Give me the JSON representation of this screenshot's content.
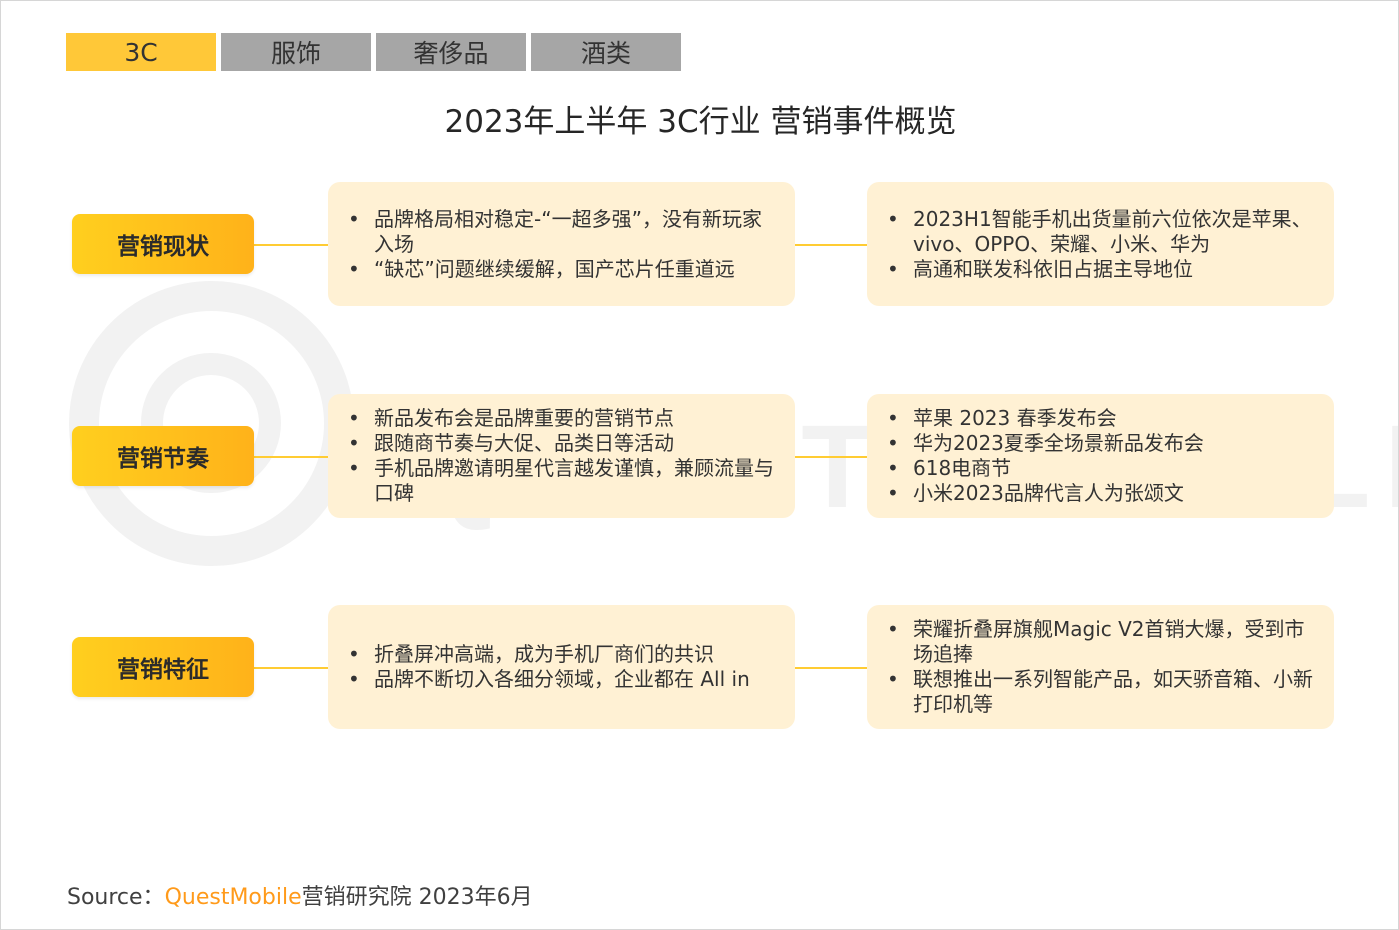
{
  "tabs": [
    {
      "label": "3C",
      "active": true
    },
    {
      "label": "服饰",
      "active": false
    },
    {
      "label": "奢侈品",
      "active": false
    },
    {
      "label": "酒类",
      "active": false
    }
  ],
  "title": "2023年上半年 3C行业 营销事件概览",
  "watermark": "QUEST MOBILE",
  "rows": [
    {
      "label": "营销现状",
      "left": [
        "品牌格局相对稳定-“一超多强”，没有新玩家入场",
        "“缺芯”问题继续缓解，国产芯片任重道远"
      ],
      "right": [
        "2023H1智能手机出货量前六位依次是苹果、vivo、OPPO、荣耀、小米、华为",
        "高通和联发科依旧占据主导地位"
      ]
    },
    {
      "label": "营销节奏",
      "left": [
        "新品发布会是品牌重要的营销节点",
        "跟随商节奏与大促、品类日等活动",
        "手机品牌邀请明星代言越发谨慎，兼顾流量与口碑"
      ],
      "right": [
        "苹果 2023 春季发布会",
        "华为2023夏季全场景新品发布会",
        "618电商节",
        "小米2023品牌代言人为张颂文"
      ]
    },
    {
      "label": "营销特征",
      "left": [
        "折叠屏冲高端，成为手机厂商们的共识",
        "品牌不断切入各细分领域，企业都在 All in"
      ],
      "right": [
        "荣耀折叠屏旗舰Magic V2首销大爆，受到市场追捧",
        "联想推出一系列智能产品，如天骄音箱、小新打印机等"
      ]
    }
  ],
  "source": {
    "prefix": "Source：",
    "brand": "QuestMobile",
    "suffix": "营销研究院 2023年6月"
  },
  "colors": {
    "accent": "#ffc838",
    "tab_inactive": "#a6a6a6",
    "card_bg": "#fff1d4",
    "brand_text": "#ff9a1a"
  }
}
